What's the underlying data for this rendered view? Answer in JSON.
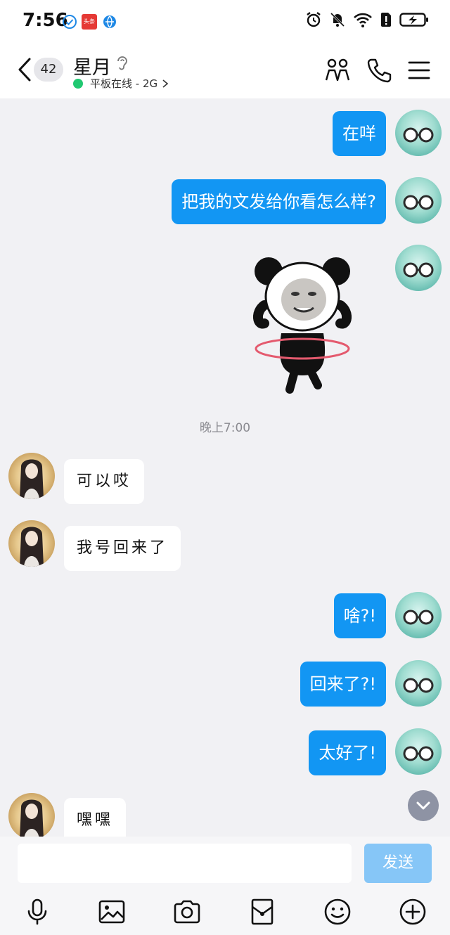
{
  "status_bar": {
    "time": "7:56",
    "app_badge_text": "头条",
    "icons": [
      "shield-check-icon",
      "news-app-icon",
      "browser-icon",
      "alarm-icon",
      "mute-icon",
      "wifi-icon",
      "sim-alert-icon",
      "battery-charging-icon"
    ]
  },
  "header": {
    "back_count": "42",
    "title": "星月",
    "subtitle": "平板在线 - 2G",
    "online_color": "#20c871",
    "icons": [
      "back-chevron-icon",
      "ear-icon",
      "people-icon",
      "phone-icon",
      "menu-icon"
    ]
  },
  "messages": [
    {
      "side": "out",
      "text": "在咩"
    },
    {
      "side": "out",
      "text": "把我的文发给你看怎么样?"
    },
    {
      "side": "out",
      "type": "sticker",
      "text": ""
    },
    {
      "side": "timestamp",
      "text": "晚上7:00"
    },
    {
      "side": "in",
      "text": "可以哎"
    },
    {
      "side": "in",
      "text": "我号回来了"
    },
    {
      "side": "out",
      "text": "啥?!"
    },
    {
      "side": "out",
      "text": "回来了?!"
    },
    {
      "side": "out",
      "text": "太好了!"
    },
    {
      "side": "in",
      "text": "嘿嘿"
    }
  ],
  "composer": {
    "input_value": "",
    "send_label": "发送"
  },
  "toolbar": {
    "icons": [
      "microphone-icon",
      "image-icon",
      "camera-icon",
      "red-packet-icon",
      "emoji-icon",
      "add-icon"
    ]
  },
  "colors": {
    "out_bubble": "#1296f3",
    "in_bubble": "#ffffff",
    "background": "#f1f1f4",
    "send_button": "#86c6f7"
  }
}
